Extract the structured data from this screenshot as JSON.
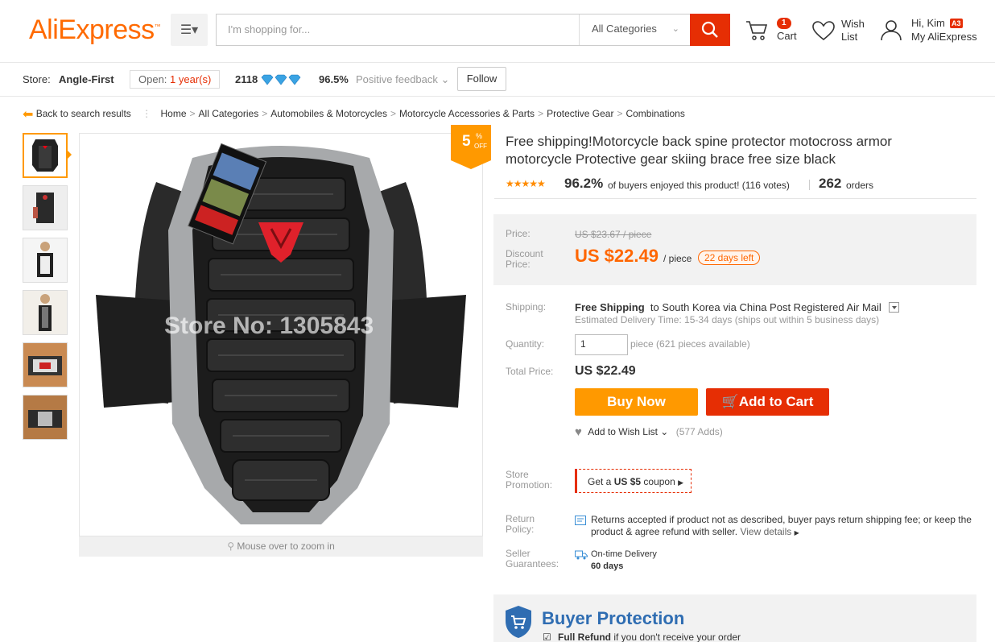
{
  "header": {
    "logo": "AliExpress",
    "logo_mark": "™",
    "search_placeholder": "I'm shopping for...",
    "search_category": "All Categories",
    "cart_label": "Cart",
    "cart_count": "1",
    "wish_label": "Wish List",
    "account_greeting": "Hi, Kim",
    "account_badge": "A3",
    "account_link": "My AliExpress"
  },
  "store": {
    "label": "Store:",
    "name": "Angle-First",
    "open_label": "Open:",
    "open_years": "1 year(s)",
    "score": "2118",
    "feedback_pct": "96.5%",
    "feedback_label": "Positive feedback",
    "follow": "Follow"
  },
  "breadcrumb": {
    "back": "Back to search results",
    "items": [
      "Home",
      "All Categories",
      "Automobiles & Motorcycles",
      "Motorcycle Accessories & Parts",
      "Protective Gear",
      "Combinations"
    ]
  },
  "gallery": {
    "zoom_hint": "Mouse over to zoom in",
    "watermark": "Store No: 1305843",
    "discount_pct": "5",
    "discount_sym": "%",
    "discount_off": "OFF",
    "thumb_count": 6
  },
  "product": {
    "title": "Free shipping!Motorcycle back spine protector motocross armor motorcycle Protective gear skiing brace free size black",
    "rating_pct": "96.2%",
    "rating_text": "of buyers enjoyed this product! (116 votes)",
    "orders": "262",
    "orders_label": "orders",
    "stars": 4.8
  },
  "pricing": {
    "price_label": "Price:",
    "old_price": "US $23.67 / piece",
    "discount_label": "Discount Price:",
    "new_price": "US $22.49",
    "per_piece": "/ piece",
    "days_left": "22 days left"
  },
  "purchase": {
    "shipping_label": "Shipping:",
    "free_shipping": "Free Shipping",
    "shipping_dest": "to South Korea via China Post Registered Air Mail",
    "delivery_est": "Estimated Delivery Time: 15-34 days (ships out within 5 business days)",
    "quantity_label": "Quantity:",
    "quantity_value": "1",
    "quantity_avail": "piece (621 pieces available)",
    "total_label": "Total Price:",
    "total_value": "US $22.49",
    "buy_now": "Buy Now",
    "add_to_cart": "Add to Cart",
    "wishlist_label": "Add to Wish List",
    "wishlist_adds": "(577 Adds)"
  },
  "promotion": {
    "label": "Store Promotion:",
    "coupon_pre": "Get a",
    "coupon_amount": "US $5",
    "coupon_post": "coupon"
  },
  "return_policy": {
    "label": "Return Policy:",
    "text": "Returns accepted if product not as described, buyer pays return shipping fee; or keep the product & agree refund with seller.",
    "view": "View details"
  },
  "guarantees": {
    "label": "Seller Guarantees:",
    "title": "On-time Delivery",
    "days": "60 days"
  },
  "buyer_protection": {
    "title": "Buyer Protection",
    "refund_bold": "Full Refund",
    "refund_text": "if you don't receive your order"
  },
  "colors": {
    "accent": "#e62e04",
    "orange": "#ff9900",
    "price_orange": "#ff6600",
    "blue": "#2f6db2"
  }
}
